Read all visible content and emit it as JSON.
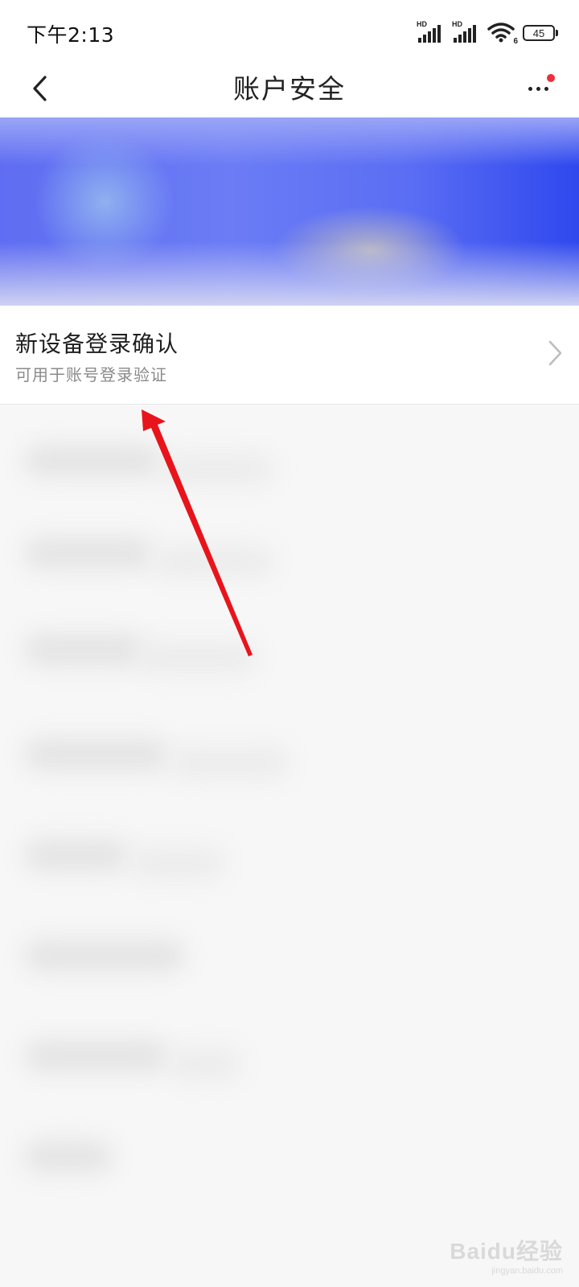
{
  "status_bar": {
    "time": "下午2:13",
    "network_label_1": "HD",
    "network_label_2": "HD",
    "wifi_label": "6",
    "battery_level": "45",
    "icons": [
      "signal-icon",
      "signal-icon",
      "wifi-icon",
      "battery-icon"
    ]
  },
  "nav": {
    "title": "账户安全",
    "back_icon": "chevron-left-icon",
    "more_icon": "more-horizontal-icon",
    "notification_dot_color": "#f02d3a"
  },
  "banner": {
    "accent_color": "#3a52ee"
  },
  "options": [
    {
      "title": "新设备登录确认",
      "subtitle": "可用于账号登录验证",
      "icon": "chevron-right-icon"
    }
  ],
  "annotation": {
    "color": "#e8141c"
  },
  "watermark": {
    "logo": "Baidu经验",
    "site": "jingyan.baidu.com"
  }
}
